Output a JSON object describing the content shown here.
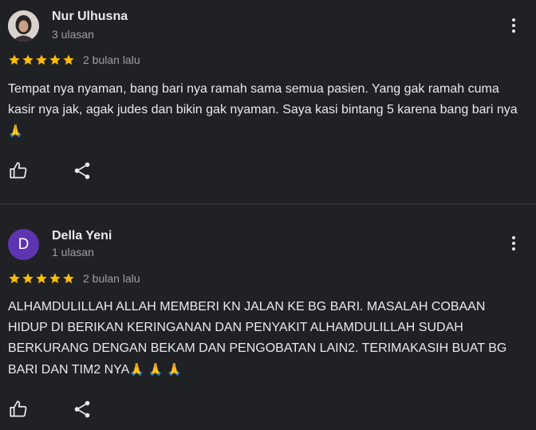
{
  "reviews": [
    {
      "name": "Nur Ulhusna",
      "review_count": "3 ulasan",
      "stars": 5,
      "time": "2 bulan lalu",
      "text": "Tempat nya nyaman, bang bari nya ramah sama semua pasien. Yang gak ramah cuma kasir nya jak, agak judes dan bikin gak nyaman. Saya kasi bintang 5 karena bang bari nya",
      "emojis": "🙏",
      "avatar_type": "photo"
    },
    {
      "name": "Della Yeni",
      "review_count": "1 ulasan",
      "stars": 5,
      "time": "2 bulan lalu",
      "text": "ALHAMDULILLAH ALLAH MEMBERI KN JALAN KE BG BARI. MASALAH COBAAN HIDUP DI BERIKAN KERINGANAN DAN PENYAKIT ALHAMDULILLAH SUDAH BERKURANG DENGAN BEKAM DAN PENGOBATAN LAIN2. TERIMAKASIH BUAT BG BARI DAN TIM2 NYA",
      "emojis": "🙏 🙏 🙏",
      "avatar_type": "letter",
      "avatar_letter": "D"
    }
  ],
  "colors": {
    "background": "#202124",
    "star": "#fbbc04",
    "avatar_letter_bg": "#5e35b1",
    "secondary_text": "#9aa0a6"
  },
  "icons": {
    "like": "thumb-up-icon",
    "share": "share-icon",
    "more": "more-vert-icon"
  }
}
